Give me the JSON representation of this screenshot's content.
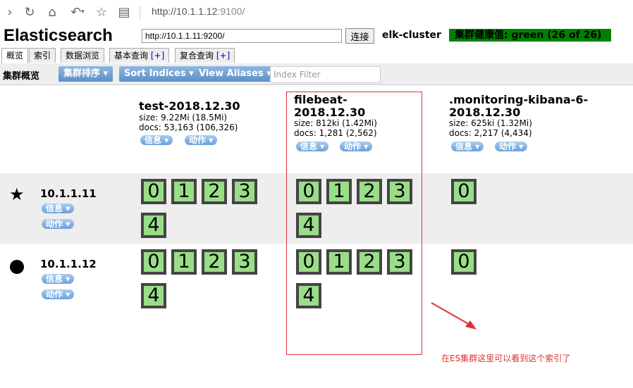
{
  "browser": {
    "url_host": "http://10.1.1.12",
    "url_port": ":9100/"
  },
  "header": {
    "title": "Elasticsearch",
    "connect_url": "http://10.1.1.11:9200/",
    "connect_label": "连接",
    "cluster_name": "elk-cluster",
    "health": "集群健康值: green (26 of 26)",
    "health_color": "#008000"
  },
  "tabs": [
    {
      "label": "概览",
      "plus": ""
    },
    {
      "label": "索引",
      "plus": ""
    },
    {
      "label": "数据浏览",
      "plus": ""
    },
    {
      "label": "基本查询",
      "plus": "[+]"
    },
    {
      "label": "复合查询",
      "plus": "[+]"
    }
  ],
  "toolbar": {
    "title": "集群概览",
    "sort_cluster": "集群排序",
    "sort_indices": "Sort Indices",
    "view_aliases": "View Aliases",
    "filter_placeholder": "Index Filter"
  },
  "indices": [
    {
      "name": "test-2018.12.30",
      "size": "size: 9.22Mi (18.5Mi)",
      "docs": "docs: 53,163 (106,326)",
      "info": "信息",
      "action": "动作"
    },
    {
      "name": "filebeat-2018.12.30",
      "name_line1": "filebeat-",
      "name_line2": "2018.12.30",
      "size": "size: 812ki (1.42Mi)",
      "docs": "docs: 1,281 (2,562)",
      "info": "信息",
      "action": "动作"
    },
    {
      "name": ".monitoring-kibana-6-2018.12.30",
      "name_line1": ".monitoring-kibana-6-",
      "name_line2": "2018.12.30",
      "size": "size: 625ki (1.32Mi)",
      "docs": "docs: 2,217 (4,434)",
      "info": "信息",
      "action": "动作"
    }
  ],
  "nodes": [
    {
      "name": "10.1.1.11",
      "icon": "star-icon",
      "info": "信息",
      "action": "动作",
      "shards": [
        [
          "0",
          "1",
          "2",
          "3",
          "4"
        ],
        [
          "0",
          "1",
          "2",
          "3",
          "4"
        ],
        [
          "0"
        ]
      ]
    },
    {
      "name": "10.1.1.12",
      "icon": "circle-icon",
      "info": "信息",
      "action": "动作",
      "shards": [
        [
          "0",
          "1",
          "2",
          "3",
          "4"
        ],
        [
          "0",
          "1",
          "2",
          "3",
          "4"
        ],
        [
          "0"
        ]
      ]
    }
  ],
  "annotation": "在ES集群这里可以看到这个索引了",
  "colors": {
    "shard_fill": "#99dd88",
    "shard_border": "#444444",
    "annotation": "#e03030",
    "button": "#6aa0d8"
  }
}
